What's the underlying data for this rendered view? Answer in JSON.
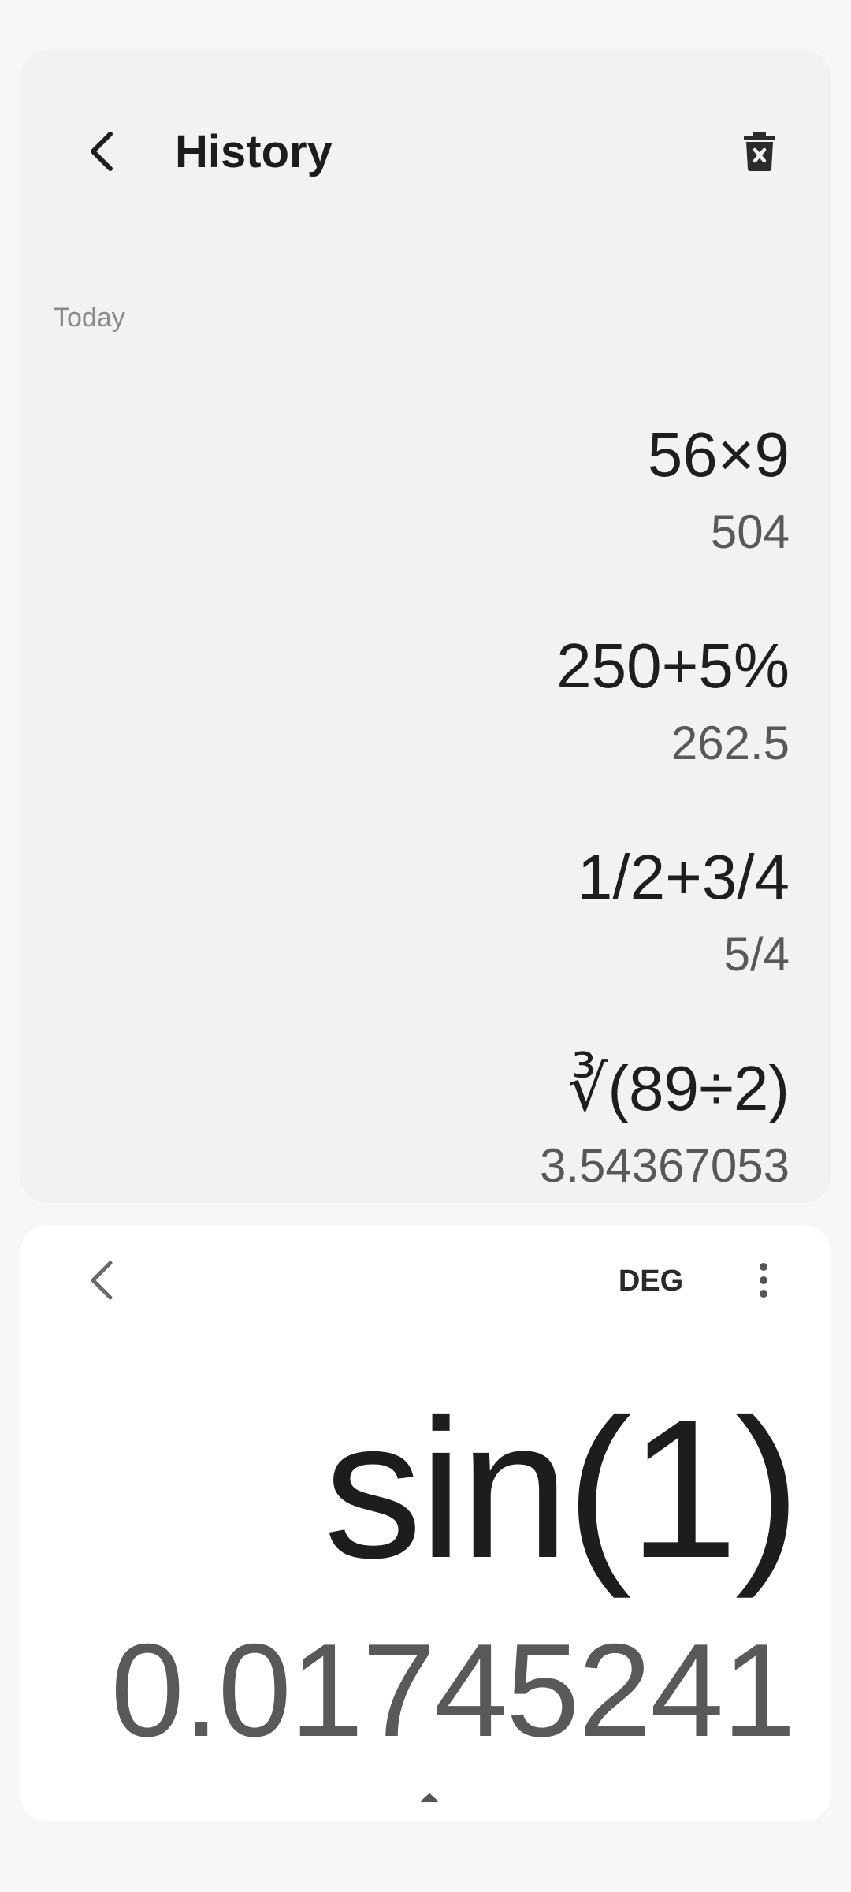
{
  "history": {
    "title": "History",
    "section_label": "Today",
    "entries": [
      {
        "expression": "56×9",
        "result": "504"
      },
      {
        "expression": "250+5%",
        "result": "262.5"
      },
      {
        "expression": "1/2+3/4",
        "result": "5/4"
      },
      {
        "expression": "∛(89÷2)",
        "result": "3.54367053"
      }
    ]
  },
  "calculator": {
    "angle_mode": "DEG",
    "expression": "sin(1)",
    "result": "0.01745241"
  },
  "icons": {
    "history_back": "back-arrow-icon",
    "history_delete": "trash-icon",
    "calculator_back": "back-arrow-icon",
    "more": "more-vertical-icon",
    "drag": "chevron-up-icon"
  },
  "colors": {
    "page_background": "#f7f7f7",
    "history_panel": "#f2f2f2",
    "calculator_panel": "#ffffff",
    "primary_text": "#1e1e1e",
    "secondary_text": "#595959",
    "label_text": "#8a8a8a"
  }
}
